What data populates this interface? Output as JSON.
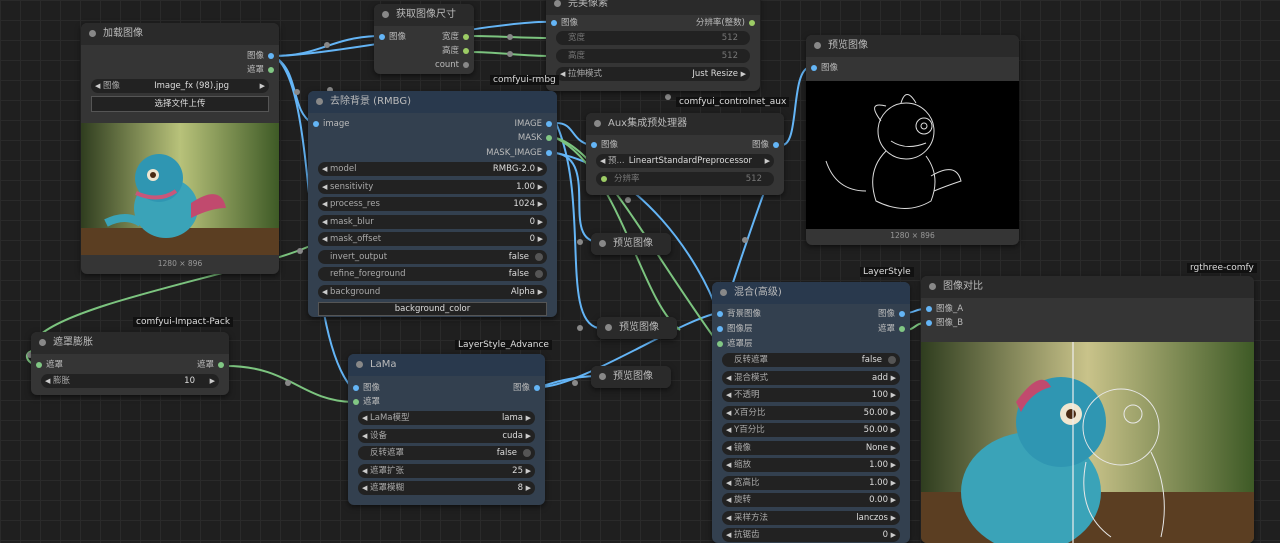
{
  "tags": {
    "rmbg": "comfyui-rmbg",
    "controlnet": "comfyui_controlnet_aux",
    "layerstyle": "LayerStyle",
    "rgthree": "rgthree-comfy",
    "impact": "comfyui-Impact-Pack",
    "layerstyle_adv": "LayerStyle_Advance"
  },
  "load_image": {
    "title": "加载图像",
    "out_image": "图像",
    "out_mask": "遮罩",
    "image_label": "图像",
    "image_value": "Image_fx (98).jpg",
    "upload_label": "选择文件上传",
    "dims": "1280 × 896"
  },
  "get_size": {
    "title": "获取图像尺寸",
    "in_image": "图像",
    "out_width": "宽度",
    "out_height": "高度",
    "out_count": "count"
  },
  "resize": {
    "title": "完美像素",
    "in_image": "图像",
    "out_resolution": "分辨率(整数)",
    "width_label": "宽度",
    "width_value": "512",
    "height_label": "高度",
    "height_value": "512",
    "mode_label": "拉伸模式",
    "mode_value": "Just Resize"
  },
  "rmbg": {
    "title": "去除背景 (RMBG)",
    "in_image": "image",
    "out_image": "IMAGE",
    "out_mask": "MASK",
    "out_mask_image": "MASK_IMAGE",
    "widgets": [
      {
        "label": "model",
        "value": "RMBG-2.0",
        "kind": "combo"
      },
      {
        "label": "sensitivity",
        "value": "1.00",
        "kind": "combo"
      },
      {
        "label": "process_res",
        "value": "1024",
        "kind": "combo"
      },
      {
        "label": "mask_blur",
        "value": "0",
        "kind": "combo"
      },
      {
        "label": "mask_offset",
        "value": "0",
        "kind": "combo"
      },
      {
        "label": "invert_output",
        "value": "false",
        "kind": "toggle"
      },
      {
        "label": "refine_foreground",
        "value": "false",
        "kind": "toggle"
      },
      {
        "label": "background",
        "value": "Alpha",
        "kind": "combo"
      }
    ],
    "bg_color_button": "background_color"
  },
  "aux": {
    "title": "Aux集成预处理器",
    "in_image": "图像",
    "out_image": "图像",
    "pre_label": "预...",
    "pre_value": "LineartStandardPreprocessor",
    "res_label": "分辨率",
    "res_value": "512"
  },
  "preview_top": {
    "title": "预览图像",
    "in_image": "图像",
    "dims": "1280 × 896"
  },
  "preview_mid": {
    "title": "预览图像"
  },
  "preview_2": {
    "title": "预览图像"
  },
  "preview_3": {
    "title": "预览图像"
  },
  "mask_grow": {
    "title": "遮罩膨胀",
    "in_mask": "遮罩",
    "out_mask": "遮罩",
    "grow_label": "膨胀",
    "grow_value": "10"
  },
  "lama": {
    "title": "LaMa",
    "in_image": "图像",
    "in_mask": "遮罩",
    "out_image": "图像",
    "widgets": [
      {
        "label": "LaMa模型",
        "value": "lama",
        "kind": "combo"
      },
      {
        "label": "设备",
        "value": "cuda",
        "kind": "combo"
      },
      {
        "label": "反转遮罩",
        "value": "false",
        "kind": "toggle"
      },
      {
        "label": "遮罩扩张",
        "value": "25",
        "kind": "combo"
      },
      {
        "label": "遮罩模糊",
        "value": "8",
        "kind": "combo"
      }
    ]
  },
  "blend": {
    "title": "混合(高级)",
    "in_bg": "背景图像",
    "in_layer": "图像层",
    "in_layer_mask": "遮罩层",
    "out_image": "图像",
    "out_mask": "遮罩",
    "widgets": [
      {
        "label": "反转遮罩",
        "value": "false",
        "kind": "toggle"
      },
      {
        "label": "混合模式",
        "value": "add",
        "kind": "combo"
      },
      {
        "label": "不透明",
        "value": "100",
        "kind": "combo"
      },
      {
        "label": "X百分比",
        "value": "50.00",
        "kind": "combo"
      },
      {
        "label": "Y百分比",
        "value": "50.00",
        "kind": "combo"
      },
      {
        "label": "镜像",
        "value": "None",
        "kind": "combo"
      },
      {
        "label": "缩放",
        "value": "1.00",
        "kind": "combo"
      },
      {
        "label": "宽高比",
        "value": "1.00",
        "kind": "combo"
      },
      {
        "label": "旋转",
        "value": "0.00",
        "kind": "combo"
      },
      {
        "label": "采样方法",
        "value": "lanczos",
        "kind": "combo"
      },
      {
        "label": "抗锯齿",
        "value": "0",
        "kind": "combo"
      }
    ]
  },
  "compare": {
    "title": "图像对比",
    "in_a": "图像_A",
    "in_b": "图像_B"
  },
  "colors": {
    "image_socket": "#64b5f6",
    "mask_socket": "#81c784",
    "wire_image": "#64b5f6",
    "wire_mask": "#7cc47f",
    "node_bg": "#353535",
    "node_blue": "#33404f"
  }
}
